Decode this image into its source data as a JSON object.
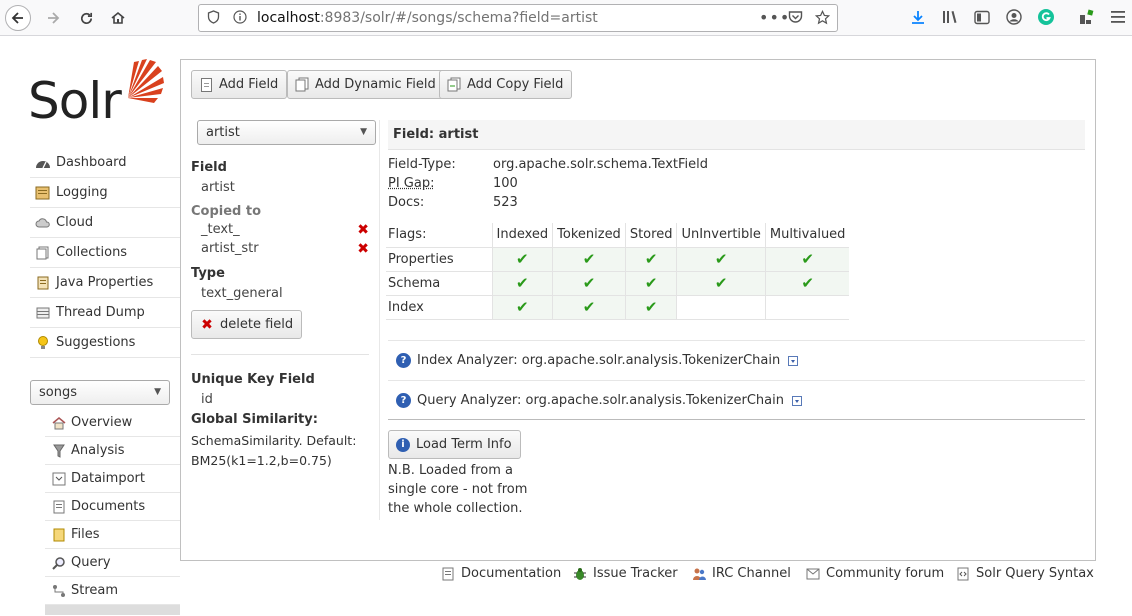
{
  "browser": {
    "url_prefix": "localhost",
    "url_rest": ":8983/solr/#/songs/schema?field=artist"
  },
  "logo": {
    "text": "Solr"
  },
  "sidebar": {
    "items": [
      {
        "label": "Dashboard",
        "icon": "dashboard-icon"
      },
      {
        "label": "Logging",
        "icon": "logging-icon"
      },
      {
        "label": "Cloud",
        "icon": "cloud-icon"
      },
      {
        "label": "Collections",
        "icon": "collections-icon"
      },
      {
        "label": "Java Properties",
        "icon": "java-properties-icon"
      },
      {
        "label": "Thread Dump",
        "icon": "thread-dump-icon"
      },
      {
        "label": "Suggestions",
        "icon": "suggestions-icon"
      }
    ],
    "core_select": "songs",
    "core_items": [
      {
        "label": "Overview",
        "icon": "overview-icon"
      },
      {
        "label": "Analysis",
        "icon": "analysis-icon"
      },
      {
        "label": "Dataimport",
        "icon": "dataimport-icon"
      },
      {
        "label": "Documents",
        "icon": "documents-icon"
      },
      {
        "label": "Files",
        "icon": "files-icon"
      },
      {
        "label": "Query",
        "icon": "query-icon"
      },
      {
        "label": "Stream",
        "icon": "stream-icon"
      }
    ]
  },
  "toolbar": {
    "add_field": "Add Field",
    "add_dynamic_field": "Add Dynamic Field",
    "add_copy_field": "Add Copy Field"
  },
  "field_select": "artist",
  "left_panel": {
    "field_heading": "Field",
    "field_value": "artist",
    "copied_heading": "Copied to",
    "copied_to": [
      "_text_",
      "artist_str"
    ],
    "type_heading": "Type",
    "type_value": "text_general",
    "delete_label": "delete field",
    "unique_key_heading": "Unique Key Field",
    "unique_key_value": "id",
    "similarity_heading": "Global Similarity:",
    "similarity_value_1": "SchemaSimilarity. Default:",
    "similarity_value_2": "BM25(k1=1.2,b=0.75)"
  },
  "field_detail": {
    "header": "Field: artist",
    "field_type_label": "Field-Type:",
    "field_type_value": "org.apache.solr.schema.TextField",
    "pi_gap_label": "PI Gap:",
    "pi_gap_value": "100",
    "docs_label": "Docs:",
    "docs_value": "523",
    "flags_label": "Flags:",
    "flag_columns": [
      "Indexed",
      "Tokenized",
      "Stored",
      "UnInvertible",
      "Multivalued"
    ],
    "flag_rows": [
      {
        "label": "Properties",
        "checks": [
          true,
          true,
          true,
          true,
          true
        ]
      },
      {
        "label": "Schema",
        "checks": [
          true,
          true,
          true,
          true,
          true
        ]
      },
      {
        "label": "Index",
        "checks": [
          true,
          true,
          true,
          false,
          false
        ]
      }
    ],
    "check_glyph": "✔",
    "index_analyzer_label": "Index Analyzer:",
    "index_analyzer_value": "org.apache.solr.analysis.TokenizerChain",
    "query_analyzer_label": "Query Analyzer:",
    "query_analyzer_value": "org.apache.solr.analysis.TokenizerChain",
    "load_term_info": "Load Term Info",
    "note": "N.B. Loaded from a single core - not from the whole collection."
  },
  "footer": {
    "documentation": "Documentation",
    "issue_tracker": "Issue Tracker",
    "irc_channel": "IRC Channel",
    "community_forum": "Community forum",
    "query_syntax": "Solr Query Syntax"
  },
  "colors": {
    "accent": "#d9411e",
    "check": "#2a9a1a",
    "delete": "#cc0000",
    "info": "#2f5fb2"
  }
}
